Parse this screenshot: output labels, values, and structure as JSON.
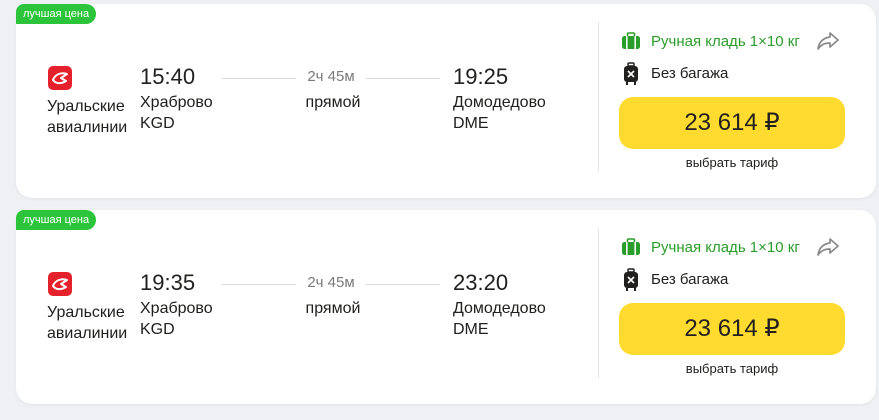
{
  "colors": {
    "badge": "#2bc43a",
    "price_button": "#ffdb2f",
    "baggage_green": "#2a9d2a",
    "airline_red": "#e5222b"
  },
  "flights": [
    {
      "badge": "лучшая цена",
      "airline": "Уральские авиалинии",
      "airline_icon": "ural-airlines-logo",
      "departure": {
        "time": "15:40",
        "airport": "Храброво",
        "code": "KGD"
      },
      "arrival": {
        "time": "19:25",
        "airport": "Домодедово",
        "code": "DME"
      },
      "duration": "2ч 45м",
      "stops": "прямой",
      "hand_baggage": "Ручная кладь 1×10 кг",
      "baggage": "Без багажа",
      "price": "23 614 ₽",
      "tariff_link": "выбрать тариф"
    },
    {
      "badge": "лучшая цена",
      "airline": "Уральские авиалинии",
      "airline_icon": "ural-airlines-logo",
      "departure": {
        "time": "19:35",
        "airport": "Храброво",
        "code": "KGD"
      },
      "arrival": {
        "time": "23:20",
        "airport": "Домодедово",
        "code": "DME"
      },
      "duration": "2ч 45м",
      "stops": "прямой",
      "hand_baggage": "Ручная кладь 1×10 кг",
      "baggage": "Без багажа",
      "price": "23 614 ₽",
      "tariff_link": "выбрать тариф"
    }
  ]
}
